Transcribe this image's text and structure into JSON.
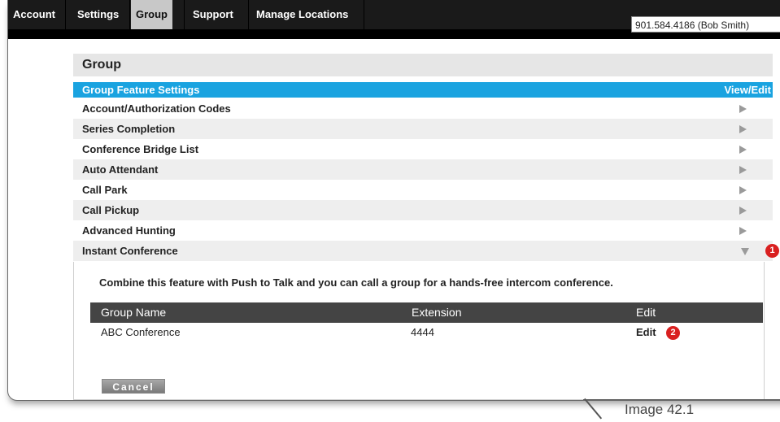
{
  "nav": {
    "account": "Account",
    "tabs": [
      {
        "label": "Settings"
      },
      {
        "label": "Group"
      },
      {
        "label": "Support"
      },
      {
        "label": "Manage Locations"
      }
    ],
    "phone_selector": "901.584.4186 (Bob Smith)"
  },
  "panel": {
    "title": "Group",
    "header_left": "Group Feature Settings",
    "header_right": "View/Edit",
    "rows": [
      {
        "label": "Account/Authorization Codes"
      },
      {
        "label": "Series Completion"
      },
      {
        "label": "Conference Bridge List"
      },
      {
        "label": "Auto Attendant"
      },
      {
        "label": "Call Park"
      },
      {
        "label": "Call Pickup"
      },
      {
        "label": "Advanced Hunting"
      },
      {
        "label": "Instant Conference"
      }
    ],
    "badge1": "1"
  },
  "instant_conference": {
    "description": "Combine this feature with Push to Talk and you can call a group for a hands-free intercom conference.",
    "columns": [
      "Group Name",
      "Extension",
      "Edit"
    ],
    "rows": [
      {
        "group_name": "ABC Conference",
        "extension": "4444",
        "edit": "Edit"
      }
    ],
    "badge2": "2",
    "cancel_label": "Cancel"
  },
  "caption": "Image 42.1",
  "colors": {
    "header_blue": "#1aa3e0",
    "badge_red": "#d92020",
    "nav_bg": "#1a1a1a"
  }
}
